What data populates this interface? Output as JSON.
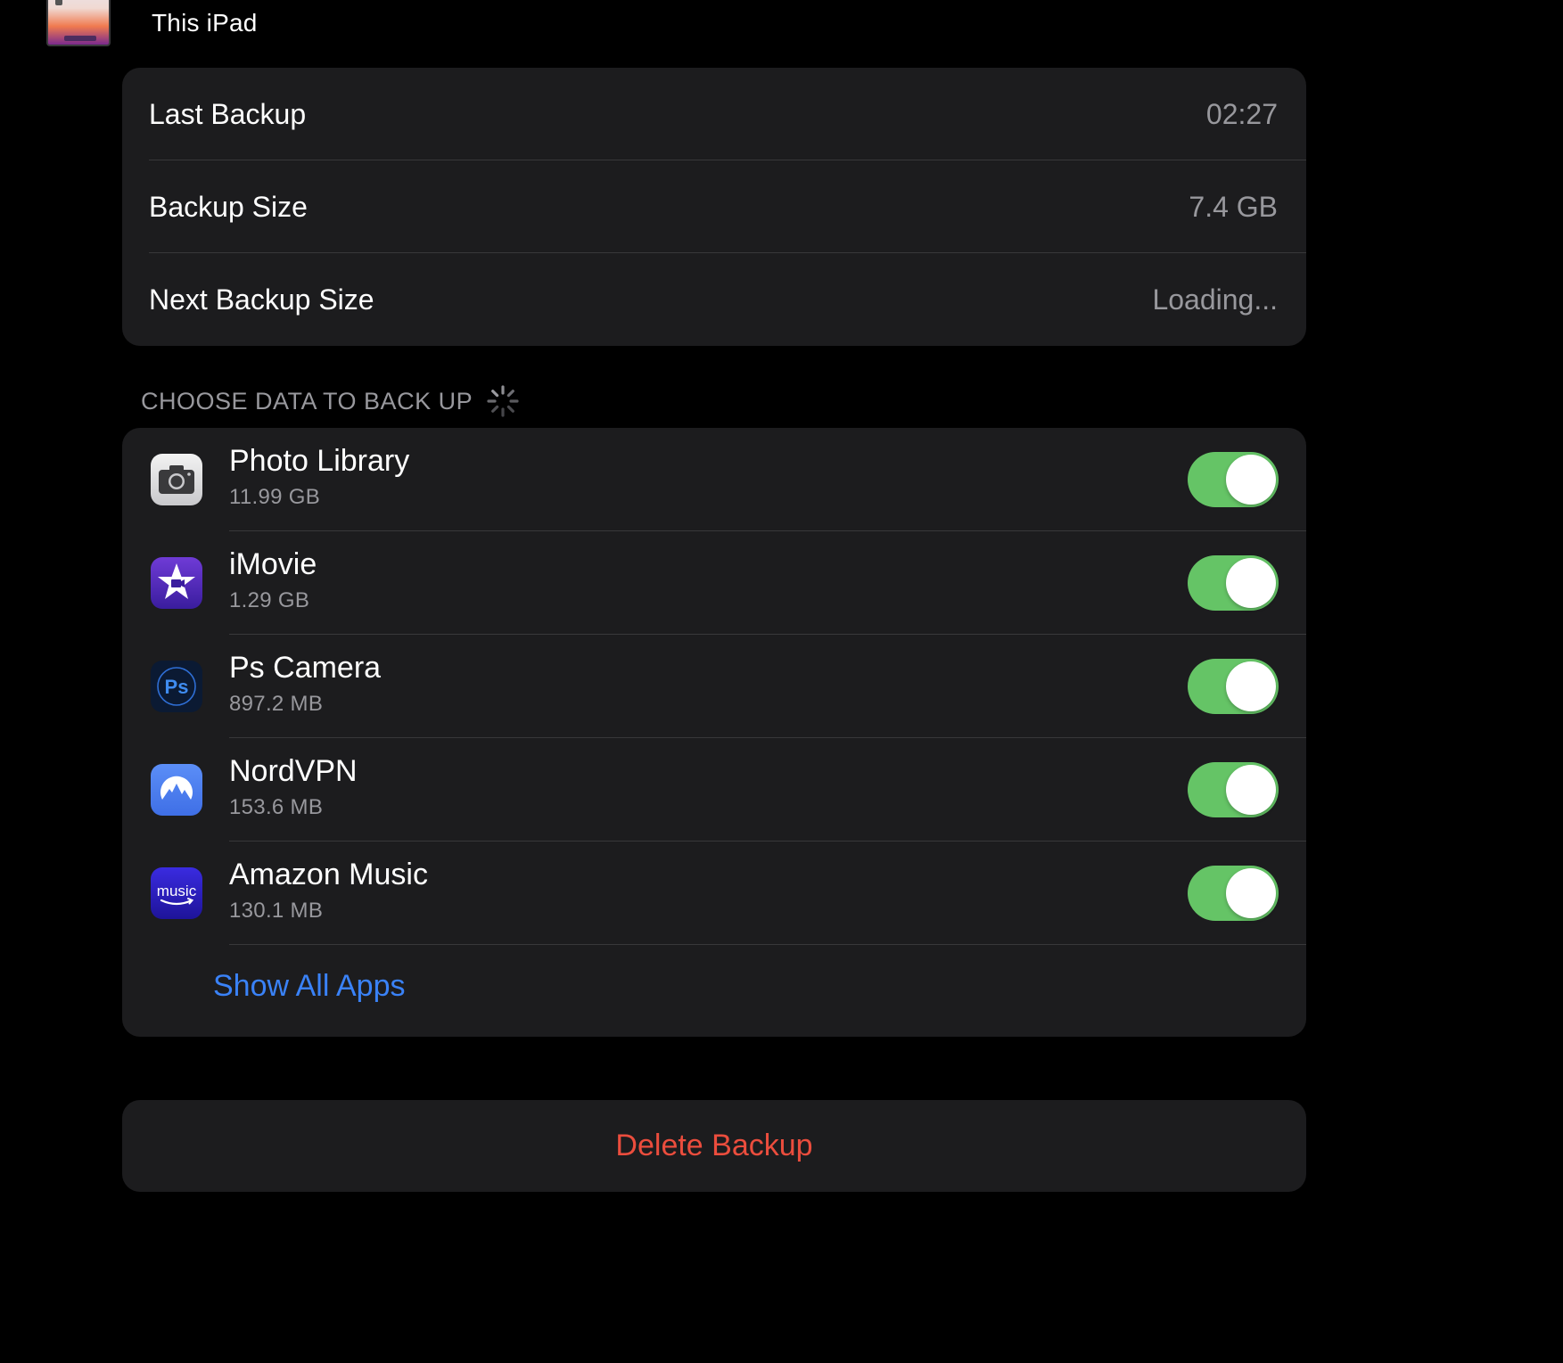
{
  "device": {
    "name": "This iPad"
  },
  "backup_info": {
    "rows": [
      {
        "label": "Last Backup",
        "value": "02:27"
      },
      {
        "label": "Backup Size",
        "value": "7.4 GB"
      },
      {
        "label": "Next Backup Size",
        "value": "Loading..."
      }
    ]
  },
  "choose_data": {
    "header": "CHOOSE DATA TO BACK UP",
    "apps": [
      {
        "name": "Photo Library",
        "size": "11.99 GB",
        "icon": "camera-icon",
        "enabled": true
      },
      {
        "name": "iMovie",
        "size": "1.29 GB",
        "icon": "imovie-star-icon",
        "enabled": true
      },
      {
        "name": "Ps Camera",
        "size": "897.2 MB",
        "icon": "ps-camera-icon",
        "enabled": true
      },
      {
        "name": "NordVPN",
        "size": "153.6 MB",
        "icon": "nordvpn-icon",
        "enabled": true
      },
      {
        "name": "Amazon Music",
        "size": "130.1 MB",
        "icon": "amazon-music-icon",
        "enabled": true
      }
    ],
    "ps_icon_text": "Ps",
    "music_icon_text": "music",
    "show_all_label": "Show All Apps"
  },
  "delete_backup": {
    "label": "Delete Backup"
  },
  "colors": {
    "background": "#000000",
    "card": "#1c1c1e",
    "secondary_text": "#98989d",
    "toggle_on": "#65c466",
    "link": "#3a82f7",
    "destructive": "#eb4d3d"
  }
}
